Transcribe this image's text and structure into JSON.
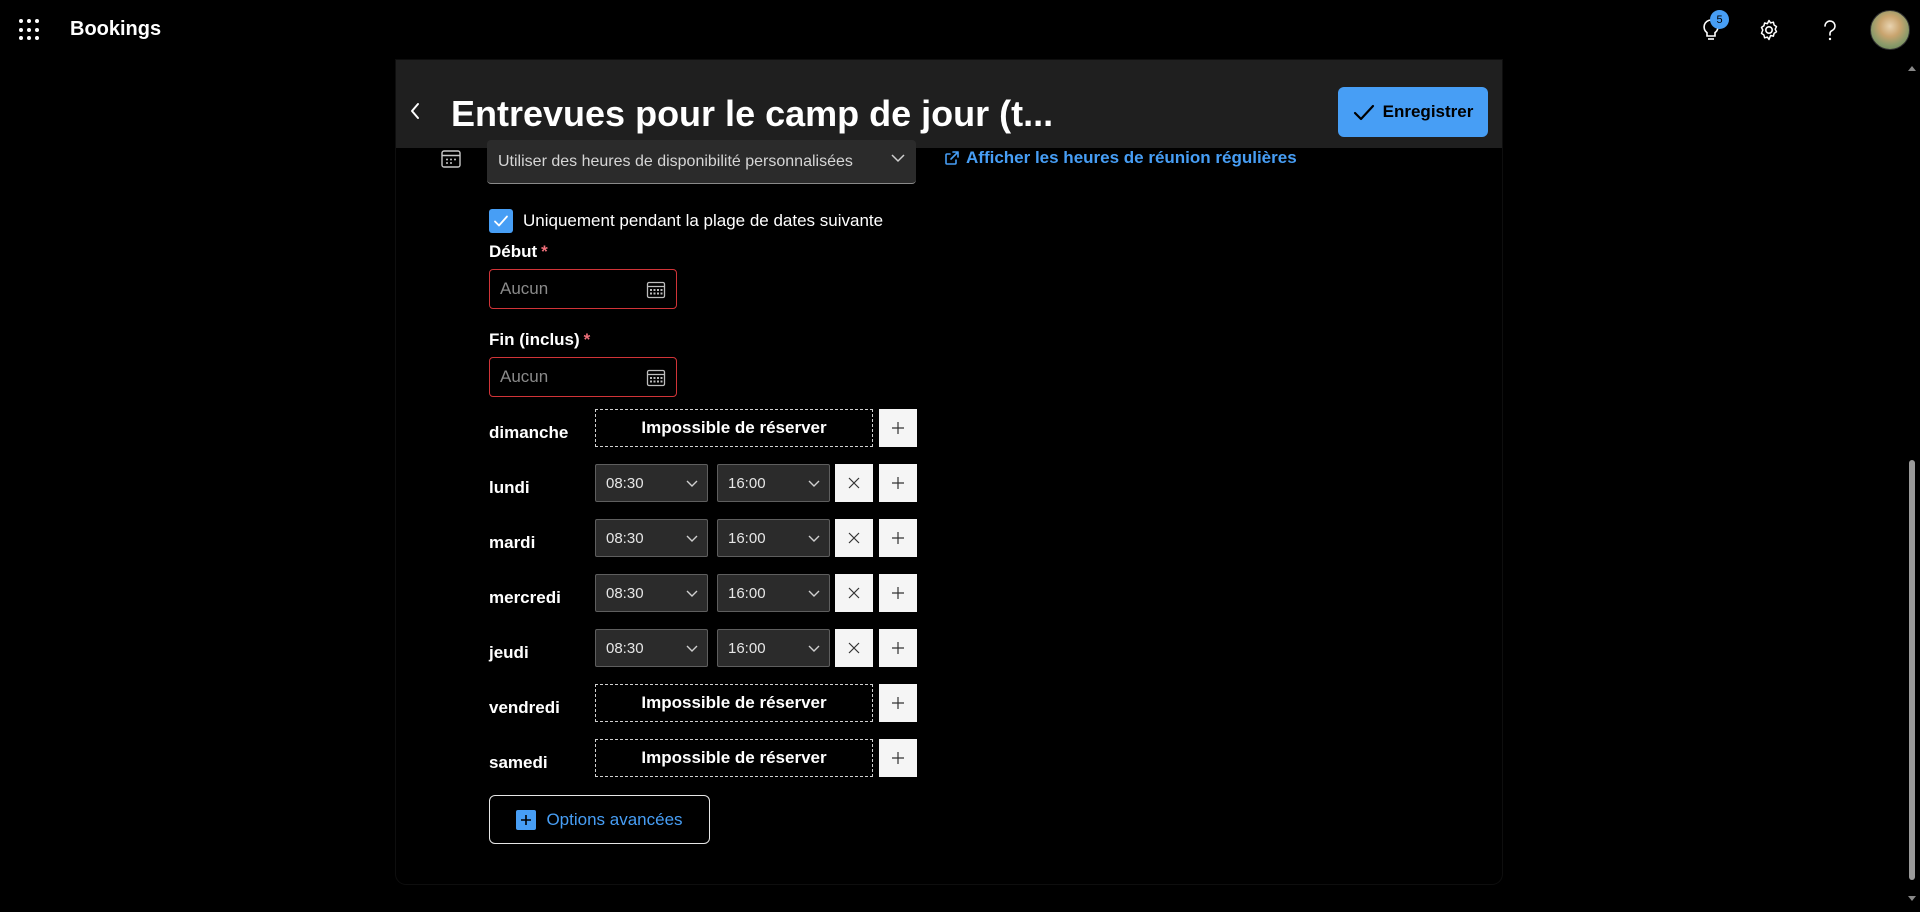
{
  "app": {
    "title": "Bookings",
    "badge_count": "5"
  },
  "panel": {
    "title": "Entrevues pour le camp de jour (t...",
    "save_label": "Enregistrer"
  },
  "availability": {
    "select_value": "Utiliser des heures de disponibilité personnalisées",
    "link_label": "Afficher les heures de réunion régulières",
    "checkbox_label": "Uniquement pendant la plage de dates suivante",
    "checkbox_checked": true
  },
  "dates": {
    "start_label": "Début",
    "start_placeholder": "Aucun",
    "end_label": "Fin (inclus)",
    "end_placeholder": "Aucun",
    "required_mark": "*"
  },
  "no_booking_label": "Impossible de réserver",
  "days": [
    {
      "name": "dimanche",
      "available": false
    },
    {
      "name": "lundi",
      "available": true,
      "start": "08:30",
      "end": "16:00"
    },
    {
      "name": "mardi",
      "available": true,
      "start": "08:30",
      "end": "16:00"
    },
    {
      "name": "mercredi",
      "available": true,
      "start": "08:30",
      "end": "16:00"
    },
    {
      "name": "jeudi",
      "available": true,
      "start": "08:30",
      "end": "16:00"
    },
    {
      "name": "vendredi",
      "available": false
    },
    {
      "name": "samedi",
      "available": false
    }
  ],
  "advanced_label": "Options avancées",
  "colors": {
    "accent": "#479ef5",
    "error": "#d13438",
    "header_bg": "#1f1f1f"
  }
}
